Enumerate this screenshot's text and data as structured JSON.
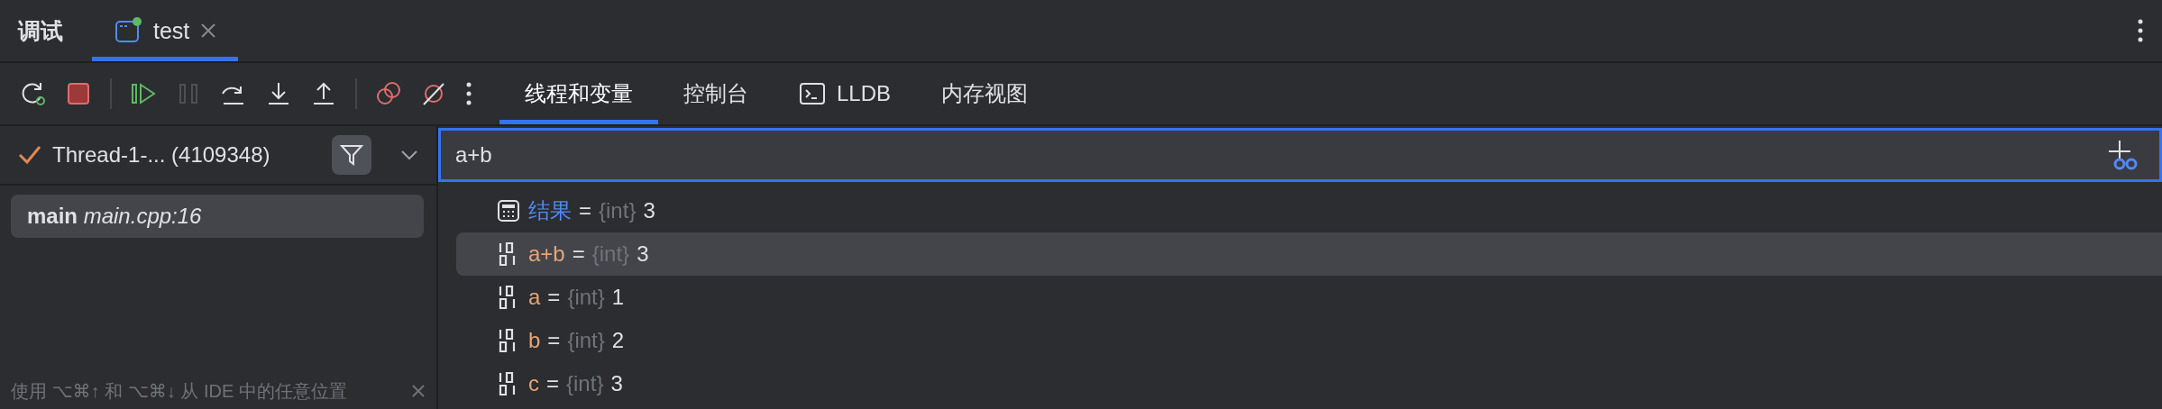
{
  "header": {
    "title": "调试",
    "tabs": [
      {
        "label": "test",
        "selected": true
      }
    ]
  },
  "toolbar": [
    {
      "kind": "rerun",
      "disabled": false
    },
    {
      "kind": "stop",
      "disabled": false
    },
    {
      "kind": "separator",
      "disabled": false
    },
    {
      "kind": "resume",
      "disabled": false
    },
    {
      "kind": "pause",
      "disabled": true
    },
    {
      "kind": "step_over",
      "disabled": false
    },
    {
      "kind": "step_into",
      "disabled": false
    },
    {
      "kind": "step_out",
      "disabled": false
    },
    {
      "kind": "separator",
      "disabled": false
    },
    {
      "kind": "breakpoints",
      "disabled": false
    },
    {
      "kind": "mute",
      "disabled": false
    },
    {
      "kind": "more",
      "disabled": false
    }
  ],
  "panel_tabs": [
    {
      "label": "线程和变量",
      "kind": "plain",
      "selected": true
    },
    {
      "label": "控制台",
      "kind": "plain",
      "selected": false
    },
    {
      "label": "LLDB",
      "kind": "terminal",
      "selected": false
    },
    {
      "label": "内存视图",
      "kind": "plain",
      "selected": false
    }
  ],
  "threads": {
    "label": "Thread-1-... (4109348)",
    "filter_on": true,
    "frames": [
      {
        "function": "main",
        "location": "main.cpp:16",
        "selected": true
      }
    ],
    "hint": "使用 ⌥⌘↑ 和 ⌥⌘↓ 从 IDE 中的任意位置"
  },
  "evaluate": {
    "value": "a+b"
  },
  "variables": [
    {
      "kind": "result",
      "name": "结果",
      "separator": "=",
      "type": "{int}",
      "value": "3",
      "selected": false
    },
    {
      "kind": "variable",
      "name": "a+b",
      "separator": "=",
      "type": "{int}",
      "value": "3",
      "selected": true
    },
    {
      "kind": "variable",
      "name": "a",
      "separator": "=",
      "type": "{int}",
      "value": "1",
      "selected": false
    },
    {
      "kind": "variable",
      "name": "b",
      "separator": "=",
      "type": "{int}",
      "value": "2",
      "selected": false
    },
    {
      "kind": "variable",
      "name": "c",
      "separator": "=",
      "type": "{int}",
      "value": "3",
      "selected": false
    }
  ]
}
